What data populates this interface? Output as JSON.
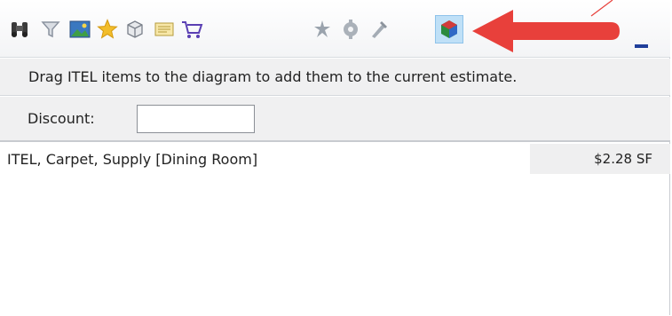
{
  "toolbar": {
    "icons": [
      {
        "name": "binoculars-icon"
      },
      {
        "name": "filter-icon"
      },
      {
        "name": "image-icon"
      },
      {
        "name": "star-icon"
      },
      {
        "name": "box-icon"
      },
      {
        "name": "document-icon"
      },
      {
        "name": "cart-icon"
      },
      {
        "name": "tool-icon-1"
      },
      {
        "name": "tool-icon-2"
      },
      {
        "name": "tool-icon-3"
      },
      {
        "name": "cube-icon",
        "active": true
      }
    ],
    "annotation_arrow_color": "#e8403b"
  },
  "info": {
    "text": "Drag ITEL items to the diagram to add them to the current estimate."
  },
  "discount": {
    "label": "Discount:",
    "value": ""
  },
  "items": [
    {
      "description": "ITEL, Carpet, Supply [Dining Room]",
      "price": "$2.28 SF"
    }
  ]
}
